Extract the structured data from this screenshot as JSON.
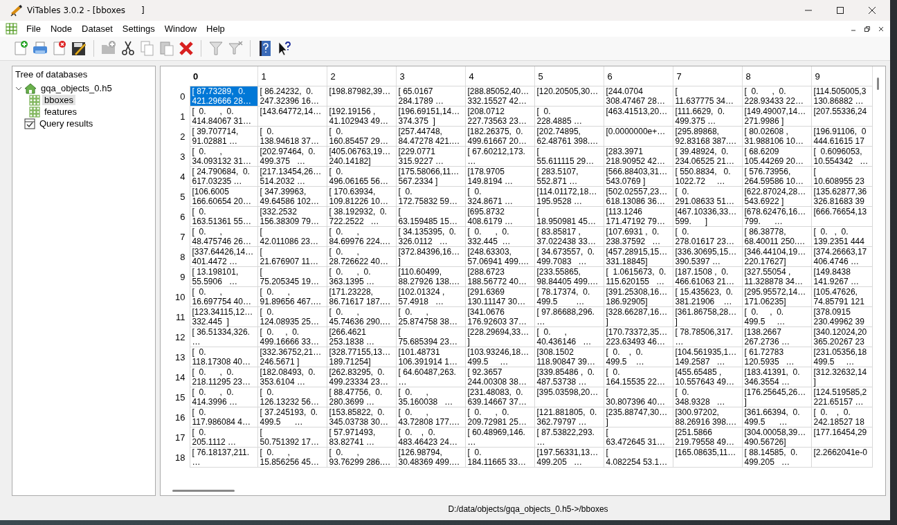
{
  "window": {
    "title": "ViTables 3.0.2 - [bboxes      ]"
  },
  "menu": [
    "File",
    "Node",
    "Dataset",
    "Settings",
    "Window",
    "Help"
  ],
  "tree": {
    "title": "Tree of databases",
    "items": [
      {
        "label": "gqa_objects_0.h5",
        "kind": "file",
        "expanded": true,
        "selected": false,
        "children": [
          {
            "label": "bboxes",
            "kind": "dataset",
            "selected": true
          },
          {
            "label": "features",
            "kind": "dataset",
            "selected": false
          }
        ]
      },
      {
        "label": "Query results",
        "kind": "queries",
        "selected": false
      }
    ]
  },
  "table": {
    "columns": [
      {
        "label": "0",
        "selected": true
      },
      {
        "label": "1",
        "selected": false
      },
      {
        "label": "2",
        "selected": false
      },
      {
        "label": "3",
        "selected": false
      },
      {
        "label": "4",
        "selected": false
      },
      {
        "label": "5",
        "selected": false
      },
      {
        "label": "6",
        "selected": false
      },
      {
        "label": "7",
        "selected": false
      },
      {
        "label": "8",
        "selected": false
      },
      {
        "label": "9",
        "selected": false
      }
    ],
    "rows": [
      {
        "label": "0",
        "cells": [
          {
            "text": "[ 87.73289,  0.\n421.29666 28…",
            "selected": true
          },
          {
            "text": "[ 86.24232,  0.\n247.32396 16…",
            "selected": false
          },
          {
            "text": "[198.87982,39…",
            "selected": false
          },
          {
            "text": "[ 65.0167\n284.1789 …",
            "selected": false
          },
          {
            "text": "[288.85052,40…\n332.15527 42…",
            "selected": false
          },
          {
            "text": "[120.20505,30…",
            "selected": false
          },
          {
            "text": "[244.0704\n308.47467 28…",
            "selected": false
          },
          {
            "text": "[\n11.637775 34…",
            "selected": false
          },
          {
            "text": "[  0.      ,  0.\n228.93433 22…",
            "selected": false
          },
          {
            "text": "[114.505005,3\n130.86882 …",
            "selected": false
          }
        ]
      },
      {
        "label": "1",
        "cells": [
          {
            "text": "[  0.      ,  0.\n414.84067 31…",
            "selected": false
          },
          {
            "text": "[143.64772,14…",
            "selected": false
          },
          {
            "text": "[192.19156 ,\n41.102943 49…",
            "selected": false
          },
          {
            "text": "[196.69151,14…\n374.375  ]",
            "selected": false
          },
          {
            "text": "[208.0712\n227.73563 23…",
            "selected": false
          },
          {
            "text": "[  0.\n228.4885 …",
            "selected": false
          },
          {
            "text": "[463.41513,20…",
            "selected": false
          },
          {
            "text": "[111.6629,  0.\n499.375 …",
            "selected": false
          },
          {
            "text": "[149.49007,14…\n271.9986 ]",
            "selected": false
          },
          {
            "text": "[207.55336,24",
            "selected": false
          }
        ]
      },
      {
        "label": "2",
        "cells": [
          {
            "text": "[ 39.707714,\n91.02881 …",
            "selected": false
          },
          {
            "text": "[  0.\n138.94618 37…",
            "selected": false
          },
          {
            "text": "[  0.\n160.85457 29…",
            "selected": false
          },
          {
            "text": "[257.44748,\n84.47278 421.…",
            "selected": false
          },
          {
            "text": "[182.26375,  0.\n499.61667 20…",
            "selected": false
          },
          {
            "text": "[202.74895,\n62.48761 398.…",
            "selected": false
          },
          {
            "text": "[0.0000000e+…",
            "selected": false
          },
          {
            "text": "[295.89868,\n92.83168 387.…",
            "selected": false
          },
          {
            "text": "[ 80.02608 ,\n31.988106 10…",
            "selected": false
          },
          {
            "text": "[196.91106,  0\n444.61615 17",
            "selected": false
          }
        ]
      },
      {
        "label": "3",
        "cells": [
          {
            "text": "[  0.      ,\n34.093132 31…",
            "selected": false
          },
          {
            "text": "[202.97464,  0.\n499.375   …",
            "selected": false
          },
          {
            "text": "[405.06763,19…\n240.14182]",
            "selected": false
          },
          {
            "text": "[229.0771\n315.9227 …",
            "selected": false
          },
          {
            "text": "[ 67.60212,173.\n…",
            "selected": false
          },
          {
            "text": "[\n55.611115 29…",
            "selected": false
          },
          {
            "text": "[283.3971\n218.90952 42…",
            "selected": false
          },
          {
            "text": "[ 39.48924,  0.\n234.06525 21…",
            "selected": false
          },
          {
            "text": "[ 68.6209\n105.44269 20…",
            "selected": false
          },
          {
            "text": "[  0.6096053,\n10.554342   …",
            "selected": false
          }
        ]
      },
      {
        "label": "4",
        "cells": [
          {
            "text": "[ 24.790684,  0.\n617.03235 …",
            "selected": false
          },
          {
            "text": "[217.13454,26…\n514.2032 …",
            "selected": false
          },
          {
            "text": "[  0.\n496.06165 56…",
            "selected": false
          },
          {
            "text": "[175.58066,11…\n567.2334 ]",
            "selected": false
          },
          {
            "text": "[178.9705\n149.8194 …",
            "selected": false
          },
          {
            "text": "[ 283.5107,\n552.871 …",
            "selected": false
          },
          {
            "text": "[566.88403,31…\n543.0769 ]",
            "selected": false
          },
          {
            "text": "[ 550.8834,   0.\n1022.72     …",
            "selected": false
          },
          {
            "text": "[ 576.73956,\n264.59586 10…",
            "selected": false
          },
          {
            "text": "[\n10.608955 23",
            "selected": false
          }
        ]
      },
      {
        "label": "5",
        "cells": [
          {
            "text": "[106.6005\n166.60654 20…",
            "selected": false
          },
          {
            "text": "[ 347.39963,\n49.64586 102…",
            "selected": false
          },
          {
            "text": "[ 170.63934,\n109.81226 10…",
            "selected": false
          },
          {
            "text": "[  0.\n172.75832 59…",
            "selected": false
          },
          {
            "text": "[  0.\n324.8671 …",
            "selected": false
          },
          {
            "text": "[114.01172,18…\n195.9528 …",
            "selected": false
          },
          {
            "text": "[502.02557,23…\n618.13086 36…",
            "selected": false
          },
          {
            "text": "[  0.\n291.08633 51…",
            "selected": false
          },
          {
            "text": "[622.87024,28…\n543.6922 ]",
            "selected": false
          },
          {
            "text": "[135.62877,36\n326.81683 39",
            "selected": false
          }
        ]
      },
      {
        "label": "6",
        "cells": [
          {
            "text": "[  0.\n163.51361 55…",
            "selected": false
          },
          {
            "text": "[332.2532\n156.38309 79…",
            "selected": false
          },
          {
            "text": "[ 38.192932,  0.\n722.2522   …",
            "selected": false
          },
          {
            "text": "[\n63.159485 15…",
            "selected": false
          },
          {
            "text": "[695.8732\n408.6179 …",
            "selected": false
          },
          {
            "text": "[\n18.950981 45…",
            "selected": false
          },
          {
            "text": "[113.1246\n171.47192 79…",
            "selected": false
          },
          {
            "text": "[467.10336,33…\n599.      ]",
            "selected": false
          },
          {
            "text": "[678.62476,16…\n799.      …",
            "selected": false
          },
          {
            "text": "[666.76654,13",
            "selected": false
          }
        ]
      },
      {
        "label": "7",
        "cells": [
          {
            "text": "[  0.      ,\n48.475746 26…",
            "selected": false
          },
          {
            "text": "[\n42.011086 23…",
            "selected": false
          },
          {
            "text": "[  0.      ,\n84.69976 224.…",
            "selected": false
          },
          {
            "text": "[ 34.135395,  0.\n326.0112   …",
            "selected": false
          },
          {
            "text": "[  0.      ,  0.\n332.445  …",
            "selected": false
          },
          {
            "text": "[ 83.85817 ,\n37.022438 33…",
            "selected": false
          },
          {
            "text": "[107.6931 ,  0.\n238.37592   …",
            "selected": false
          },
          {
            "text": "[  0.\n278.01617 23…",
            "selected": false
          },
          {
            "text": "[ 86.38778,\n68.40011 250.…",
            "selected": false
          },
          {
            "text": "[  0.   ,  0.\n139.2351 444",
            "selected": false
          }
        ]
      },
      {
        "label": "8",
        "cells": [
          {
            "text": "[337.64426,14…\n401.4472 …",
            "selected": false
          },
          {
            "text": "[\n21.676907 11…",
            "selected": false
          },
          {
            "text": "[  0.      ,\n28.726622 40…",
            "selected": false
          },
          {
            "text": "[372.84396,16…\n]",
            "selected": false
          },
          {
            "text": "[248.63303,\n57.06941 499.…",
            "selected": false
          },
          {
            "text": "[ 34.673557,  0.\n499.7083   …",
            "selected": false
          },
          {
            "text": "[457.28915,15…\n331.18845]",
            "selected": false
          },
          {
            "text": "[336.30695,15…\n390.5397 …",
            "selected": false
          },
          {
            "text": "[346.44104,19…\n220.17627]",
            "selected": false
          },
          {
            "text": "[374.26663,17\n406.4746 …",
            "selected": false
          }
        ]
      },
      {
        "label": "9",
        "cells": [
          {
            "text": "[ 13.198101,\n55.5906   …",
            "selected": false
          },
          {
            "text": "[\n75.205345 19…",
            "selected": false
          },
          {
            "text": "[  0.      ,  0.\n363.1395 …",
            "selected": false
          },
          {
            "text": "[110.60499,\n88.27926 138.…",
            "selected": false
          },
          {
            "text": "[288.6723\n188.56772 40…",
            "selected": false
          },
          {
            "text": "[233.55865,\n98.84405 499.…",
            "selected": false
          },
          {
            "text": "[  1.0615673,  0.\n115.620155   …",
            "selected": false
          },
          {
            "text": "[187.1508 ,  0.\n466.61063 21…",
            "selected": false
          },
          {
            "text": "[327.55054 ,\n11.328878 34…",
            "selected": false
          },
          {
            "text": "[149.8438\n141.9267 …",
            "selected": false
          }
        ]
      },
      {
        "label": "10",
        "cells": [
          {
            "text": "[  0.      ,\n16.697754 40…",
            "selected": false
          },
          {
            "text": "[  0.      ,\n91.89656 467.…",
            "selected": false
          },
          {
            "text": "[171.23228,\n86.71617 187.…",
            "selected": false
          },
          {
            "text": "[102.01324 ,\n57.4918   …",
            "selected": false
          },
          {
            "text": "[291.6369\n130.11147 30…",
            "selected": false
          },
          {
            "text": "[ 78.17374,  0.\n499.5        …",
            "selected": false
          },
          {
            "text": "[391.25308,16…\n186.92905]",
            "selected": false
          },
          {
            "text": "[ 15.435623,  0.\n381.21906    …",
            "selected": false
          },
          {
            "text": "[295.95572,14…\n171.06235]",
            "selected": false
          },
          {
            "text": "[105.47626,\n74.85791 121",
            "selected": false
          }
        ]
      },
      {
        "label": "11",
        "cells": [
          {
            "text": "[123.34115,12…\n332.445  ]",
            "selected": false
          },
          {
            "text": "[  0.\n124.08935 25…",
            "selected": false
          },
          {
            "text": "[  0.      ,\n45.74636 290.…",
            "selected": false
          },
          {
            "text": "[  0.      ,\n25.874758 38…",
            "selected": false
          },
          {
            "text": "[341.0676\n176.92603 37…",
            "selected": false
          },
          {
            "text": "[ 97.86688,296.\n…",
            "selected": false
          },
          {
            "text": "[328.66287,16…\n]",
            "selected": false
          },
          {
            "text": "[361.86758,28…\n]",
            "selected": false
          },
          {
            "text": "[  0.     ,  0.\n499.5     …",
            "selected": false
          },
          {
            "text": "[378.0915\n230.49962 39",
            "selected": false
          }
        ]
      },
      {
        "label": "12",
        "cells": [
          {
            "text": "[ 36.51334,326.\n…",
            "selected": false
          },
          {
            "text": "[  0.     ,  0.\n499.16666 33…",
            "selected": false
          },
          {
            "text": "[266.4621\n253.1838 …",
            "selected": false
          },
          {
            "text": "[\n75.685394 23…",
            "selected": false
          },
          {
            "text": "[228.29694,33…\n]",
            "selected": false
          },
          {
            "text": "[  0.      ,\n40.436146   …",
            "selected": false
          },
          {
            "text": "[170.73372,35…\n223.63493 46…",
            "selected": false
          },
          {
            "text": "[ 78.78506,317.\n…",
            "selected": false
          },
          {
            "text": "[138.2667\n267.2736 …",
            "selected": false
          },
          {
            "text": "[340.12024,20\n365.20267 23",
            "selected": false
          }
        ]
      },
      {
        "label": "13",
        "cells": [
          {
            "text": "[  0.\n118.17308 40…",
            "selected": false
          },
          {
            "text": "[332.36752,21…\n246.5671 ]",
            "selected": false
          },
          {
            "text": "[328.77155,13…\n189.71254]",
            "selected": false
          },
          {
            "text": "[101.48731\n106.391914 1…",
            "selected": false
          },
          {
            "text": "[103.93246,18…\n499.5     …",
            "selected": false
          },
          {
            "text": "[308.1502\n118.90847 39…",
            "selected": false
          },
          {
            "text": "[  0.    ,  0.\n499.5    …",
            "selected": false
          },
          {
            "text": "[104.561935,1…\n149.2587   …",
            "selected": false
          },
          {
            "text": "[ 61.72783\n120.5935   …",
            "selected": false
          },
          {
            "text": "[231.05356,18\n499.5     …",
            "selected": false
          }
        ]
      },
      {
        "label": "14",
        "cells": [
          {
            "text": "[  0.      ,  0.\n218.11295 23…",
            "selected": false
          },
          {
            "text": "[182.08493,  0.\n353.6104 …",
            "selected": false
          },
          {
            "text": "[262.83295,  0.\n499.23334 23…",
            "selected": false
          },
          {
            "text": "[ 64.60487,263.\n…",
            "selected": false
          },
          {
            "text": "[ 92.3657\n244.00308 38…",
            "selected": false
          },
          {
            "text": "[339.85486 ,  0.\n487.53738 …",
            "selected": false
          },
          {
            "text": "[  0.\n164.15535 22…",
            "selected": false
          },
          {
            "text": "[455.65485 ,\n10.557643 49…",
            "selected": false
          },
          {
            "text": "[183.41391,  0.\n346.3554 …",
            "selected": false
          },
          {
            "text": "[312.32632,14\n]",
            "selected": false
          }
        ]
      },
      {
        "label": "15",
        "cells": [
          {
            "text": "[  0.      ,  0.\n414.3996 …",
            "selected": false
          },
          {
            "text": "[  0.\n126.13232 56…",
            "selected": false
          },
          {
            "text": "[ 88.47756,  0.\n280.3699 …",
            "selected": false
          },
          {
            "text": "[  0.      ,\n35.160038   …",
            "selected": false
          },
          {
            "text": "[231.48083,  0.\n639.14667 37…",
            "selected": false
          },
          {
            "text": "[395.03598,20…",
            "selected": false
          },
          {
            "text": "[\n30.807396 40…",
            "selected": false
          },
          {
            "text": "[  0.\n348.9328   …",
            "selected": false
          },
          {
            "text": "[176.25645,26…\n]",
            "selected": false
          },
          {
            "text": "[124.519585,2\n221.65157 …",
            "selected": false
          }
        ]
      },
      {
        "label": "16",
        "cells": [
          {
            "text": "[  0.\n117.986084 4…",
            "selected": false
          },
          {
            "text": "[ 37.245193,  0.\n499.5      …",
            "selected": false
          },
          {
            "text": "[153.85822,  0.\n345.03738 30…",
            "selected": false
          },
          {
            "text": "[  0.      ,\n43.72808 177.…",
            "selected": false
          },
          {
            "text": "[  0.      ,  0.\n209.72981 25…",
            "selected": false
          },
          {
            "text": "[121.881805,  0.\n362.79797 …",
            "selected": false
          },
          {
            "text": "[235.88747,30…\n]",
            "selected": false
          },
          {
            "text": "[300.97202,\n88.26916 398.…",
            "selected": false
          },
          {
            "text": "[361.66394,  0.\n499.5      …",
            "selected": false
          },
          {
            "text": "[  0.    ,  0.\n242.18527 18",
            "selected": false
          }
        ]
      },
      {
        "label": "17",
        "cells": [
          {
            "text": "[  0.\n205.1112 …",
            "selected": false
          },
          {
            "text": "[\n50.751392 17…",
            "selected": false
          },
          {
            "text": "[ 57.971493,\n83.82741 …",
            "selected": false
          },
          {
            "text": "[  0.    ,  0.\n483.46423 24…",
            "selected": false
          },
          {
            "text": "[ 60.48969,146.\n…",
            "selected": false
          },
          {
            "text": "[ 87.53822,293.\n…",
            "selected": false
          },
          {
            "text": "[\n63.472645 31…",
            "selected": false
          },
          {
            "text": "[251.5866\n219.79558 49…",
            "selected": false
          },
          {
            "text": "[304.00058,39…\n490.56726]",
            "selected": false
          },
          {
            "text": "[177.16454,29",
            "selected": false
          }
        ]
      },
      {
        "label": "18",
        "cells": [
          {
            "text": "[ 76.18137,211.\n…",
            "selected": false
          },
          {
            "text": "[  0.      ,\n15.856256 45…",
            "selected": false
          },
          {
            "text": "[  0.      ,\n93.76299 286.…",
            "selected": false
          },
          {
            "text": "[126.98794,\n30.48369 499.…",
            "selected": false
          },
          {
            "text": "[  0.\n184.11665 33…",
            "selected": false
          },
          {
            "text": "[197.56331,13…\n499.205   …",
            "selected": false
          },
          {
            "text": "[\n4.082254 53.1…",
            "selected": false
          },
          {
            "text": "[165.08635,11…",
            "selected": false
          },
          {
            "text": "[ 88.14585,  0.\n499.205   …",
            "selected": false
          },
          {
            "text": "[2.2662041e-0",
            "selected": false
          }
        ]
      }
    ]
  },
  "status_bar": "D:/data/objects/gqa_objects_0.h5->/bboxes"
}
